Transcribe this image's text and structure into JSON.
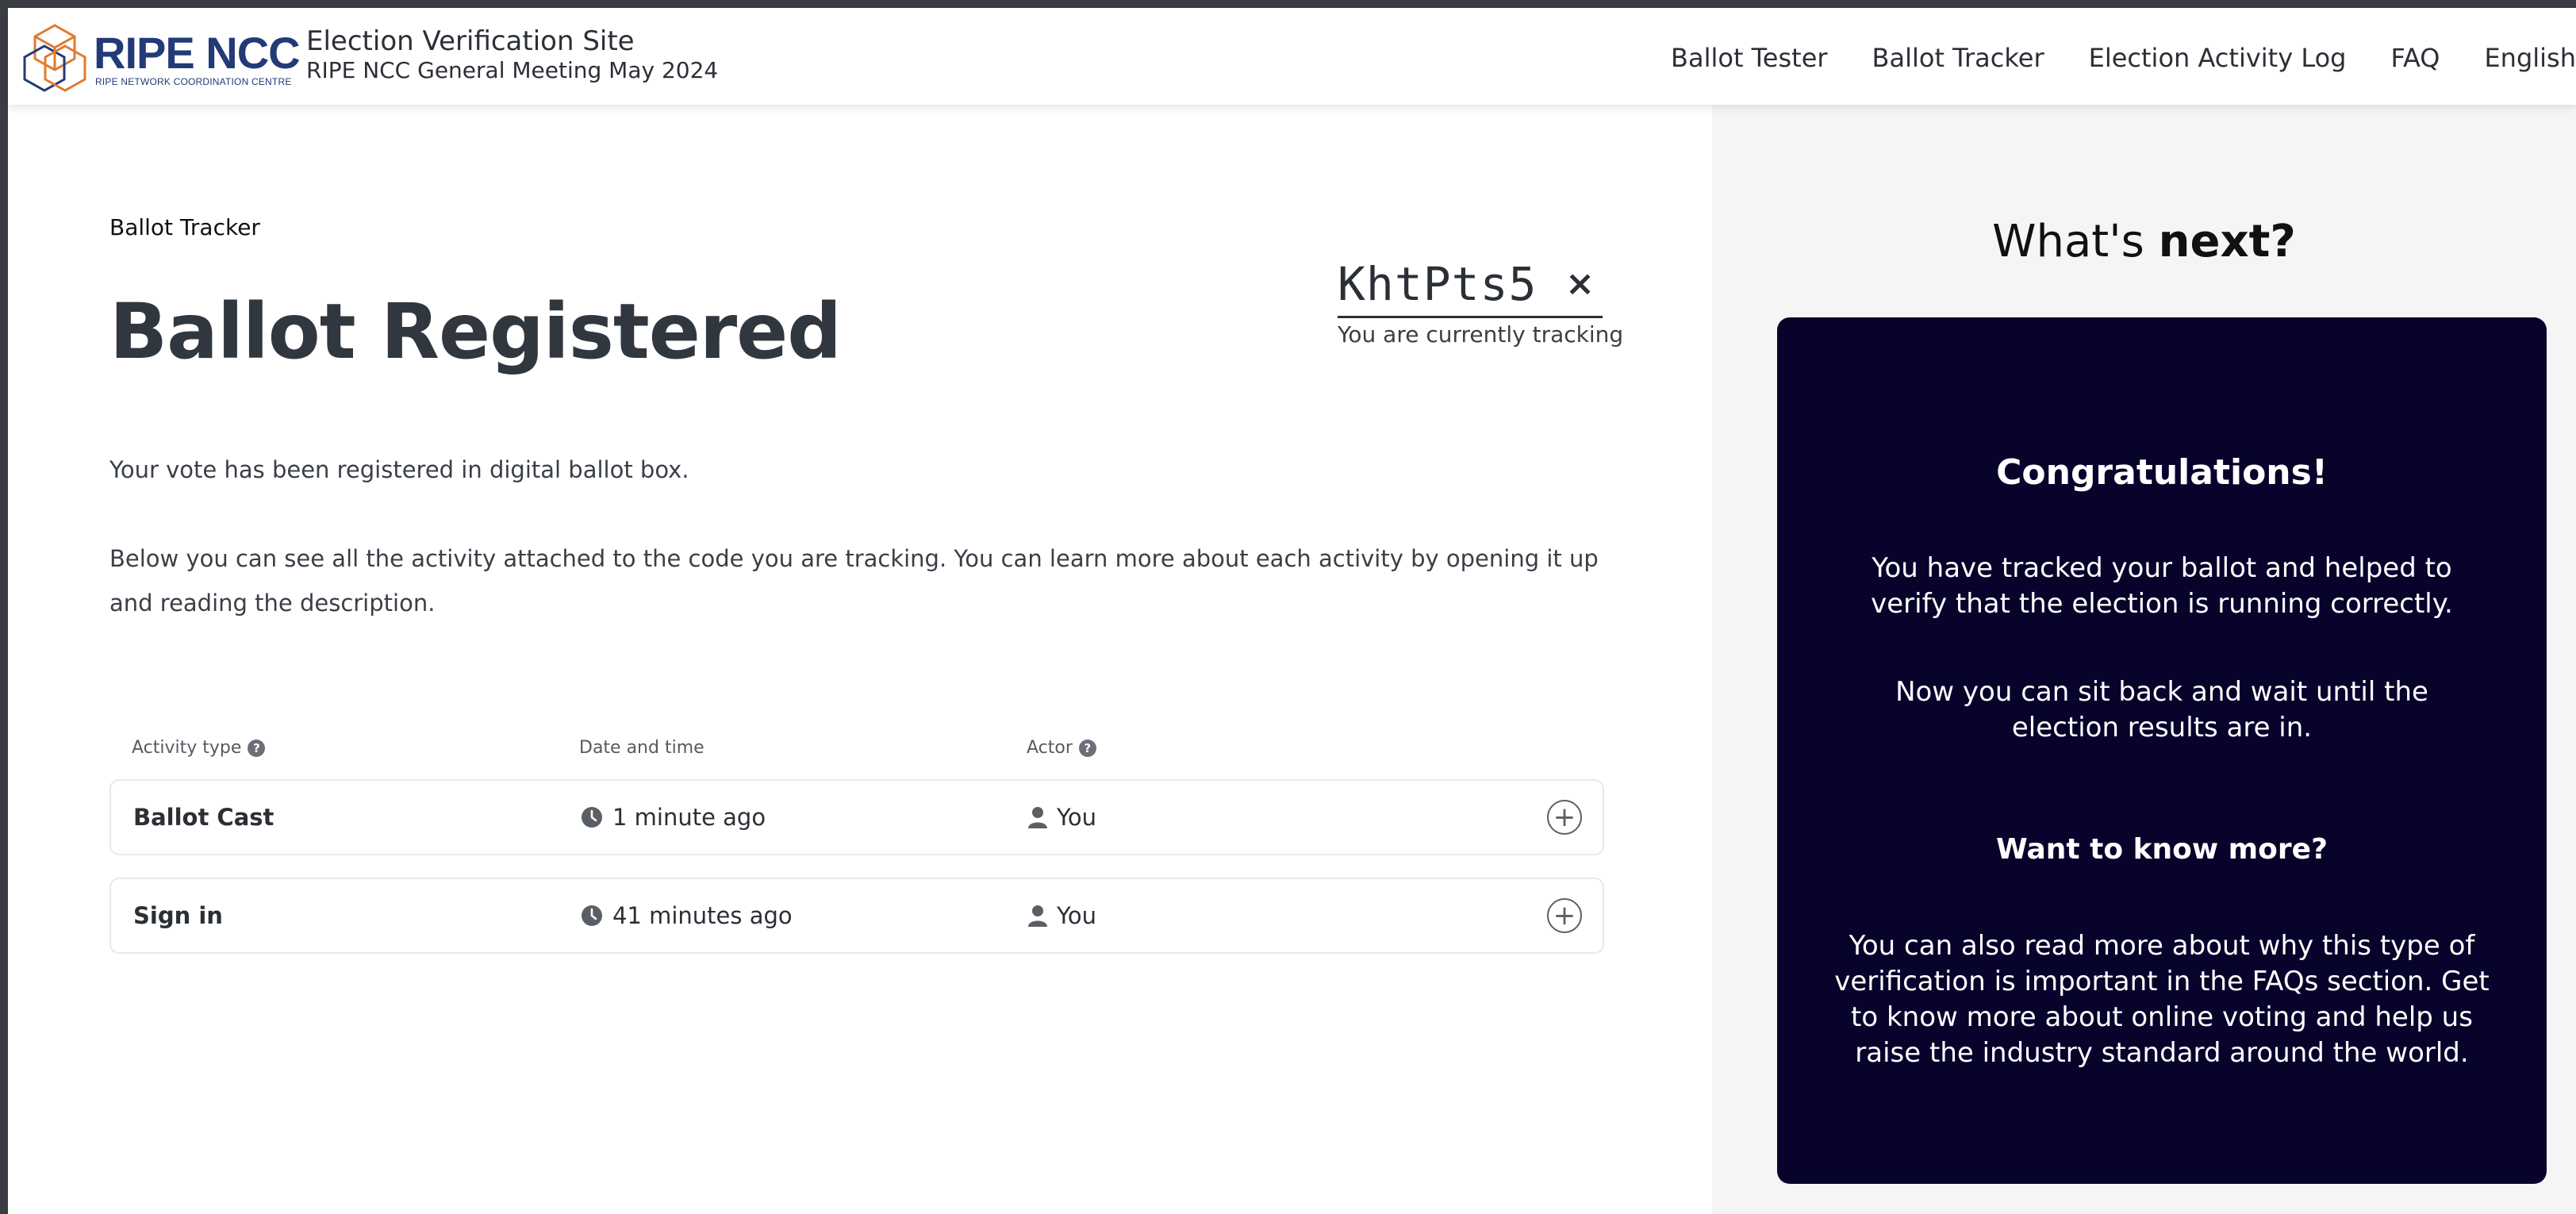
{
  "header": {
    "logo_text": "RIPE NCC",
    "logo_subtext": "RIPE NETWORK COORDINATION CENTRE",
    "site_title": "Election Verification Site",
    "site_subtitle": "RIPE NCC General Meeting May 2024",
    "nav": [
      {
        "label": "Ballot Tester"
      },
      {
        "label": "Ballot Tracker"
      },
      {
        "label": "Election Activity Log"
      },
      {
        "label": "FAQ"
      },
      {
        "label": "English"
      }
    ]
  },
  "main": {
    "breadcrumb": "Ballot Tracker",
    "title": "Ballot Registered",
    "tracking": {
      "code": "KhtPts5",
      "close_glyph": "×",
      "caption": "You are currently tracking"
    },
    "paragraph1": "Your vote has been registered in digital ballot box.",
    "paragraph2": "Below you can see all the activity attached to the code you are tracking. You can learn more about each activity by opening it up and reading the description.",
    "table": {
      "headers": {
        "activity_type": "Activity type",
        "date_time": "Date and time",
        "actor": "Actor"
      },
      "help_glyph": "?",
      "rows": [
        {
          "activity": "Ballot Cast",
          "time": "1 minute ago",
          "actor": "You",
          "expand": "+"
        },
        {
          "activity": "Sign in",
          "time": "41 minutes ago",
          "actor": "You",
          "expand": "+"
        }
      ]
    }
  },
  "aside": {
    "title_plain": "What's ",
    "title_bold": "next?",
    "card": {
      "heading": "Congratulations!",
      "p1": "You have tracked your ballot and helped to verify that the election is running correctly.",
      "p2": "Now you can sit back and wait until the election results are in.",
      "heading2": "Want to know more?",
      "p3": "You can also read more about why this type of verification is important in the FAQs section. Get to know more about online voting and help us raise the industry standard around the world."
    }
  },
  "colors": {
    "card_background": "#07032b",
    "aside_background": "#f5f5f5",
    "logo_blue": "#233a78",
    "logo_orange": "#e07b2e"
  },
  "icons": [
    "ripe-ncc-logo",
    "close-icon",
    "help-icon",
    "clock-icon",
    "user-icon",
    "expand-plus-icon"
  ]
}
